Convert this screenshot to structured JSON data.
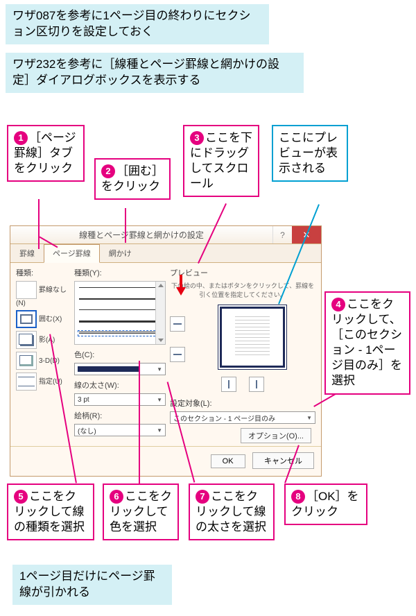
{
  "notes": {
    "top1": "ワザ087を参考に1ページ目の終わりにセクション区切りを設定しておく",
    "top2": "ワザ232を参考に［線種とページ罫線と網かけの設定］ダイアログボックスを表示する",
    "bottom": "1ページ目だけにページ罫線が引かれる",
    "preview": "ここにプレビューが表示される"
  },
  "steps": {
    "s1": "［ページ罫線］タブをクリック",
    "s2": "［囲む］をクリック",
    "s3": "ここを下にドラッグしてスクロール",
    "s4": "ここをクリックして、［このセクション - 1ページ目のみ］を選択",
    "s5": "ここをクリックして線の種類を選択",
    "s6": "ここをクリックして色を選択",
    "s7": "ここをクリックして線の太さを選択",
    "s8": "［OK］をクリック"
  },
  "dialog": {
    "title": "線種とページ罫線と網かけの設定",
    "tabs": [
      "罫線",
      "ページ罫線",
      "網かけ"
    ],
    "labels": {
      "type": "種類:",
      "style": "種類(Y):",
      "color": "色(C):",
      "width": "線の太さ(W):",
      "art": "絵柄(R):",
      "preview": "プレビュー",
      "preview_hint": "下の絵の中、またはボタンをクリックして、罫線を引く位置を指定してください。",
      "apply": "設定対象(L):"
    },
    "type_options": {
      "none": "罫線なし(N)",
      "box": "囲む(X)",
      "shadow": "影(A)",
      "threed": "3-D(D)",
      "custom": "指定(U)"
    },
    "width_value": "3 pt",
    "art_value": "(なし)",
    "apply_value": "このセクション - 1 ページ目のみ",
    "buttons": {
      "options": "オプション(O)...",
      "ok": "OK",
      "cancel": "キャンセル"
    }
  }
}
